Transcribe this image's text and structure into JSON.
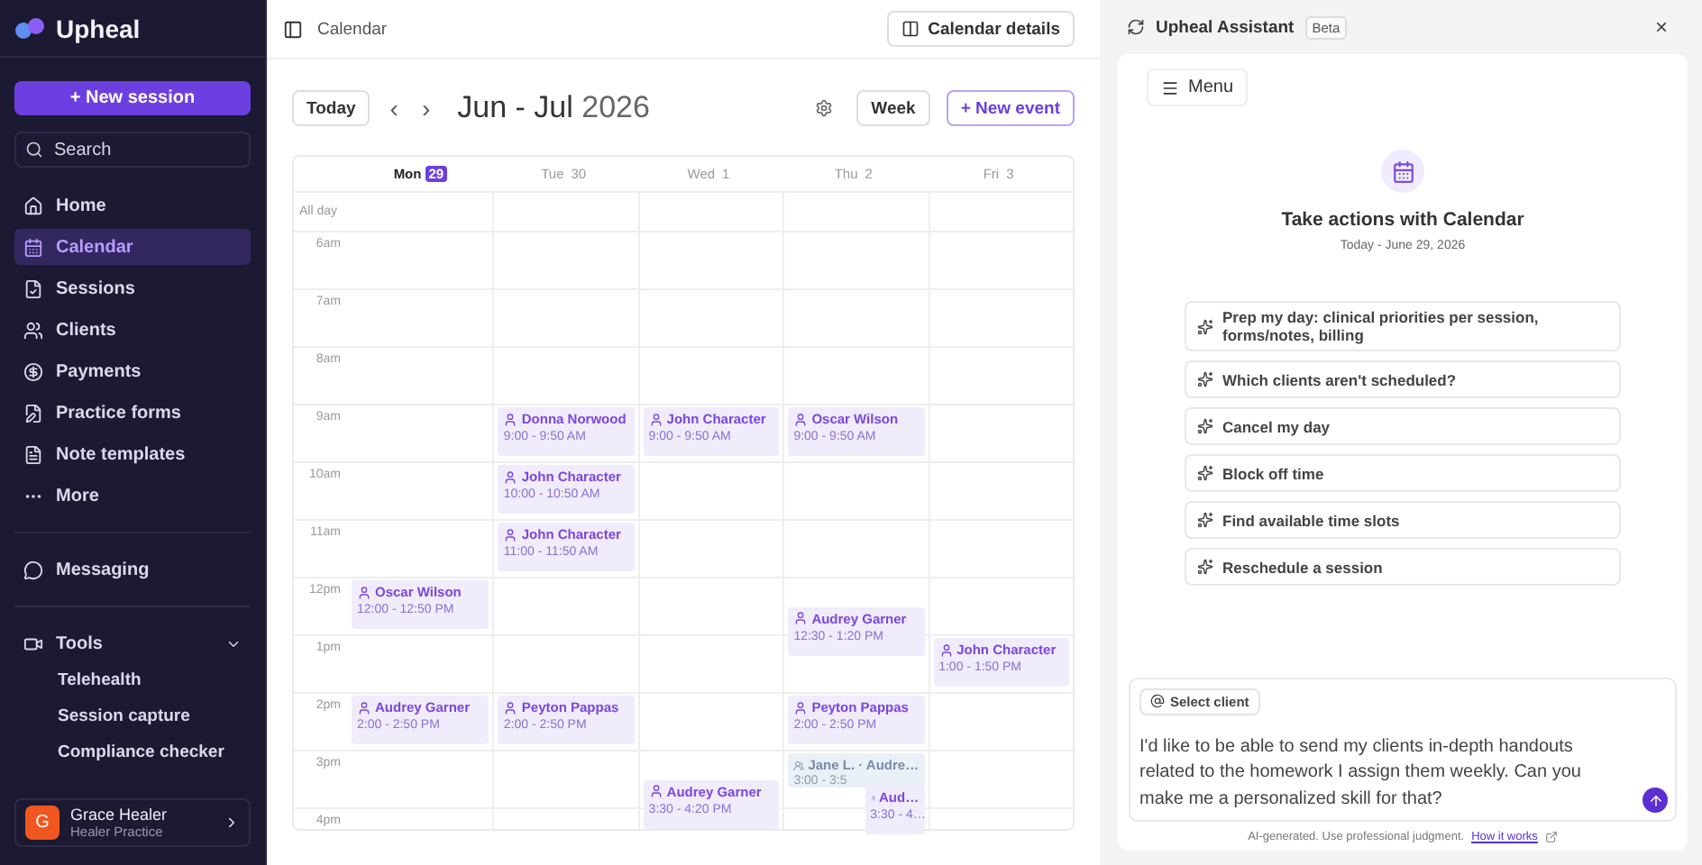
{
  "sidebar": {
    "brand": "Upheal",
    "new_session": "+ New session",
    "search_placeholder": "Search",
    "items": [
      {
        "label": "Home",
        "selected": false
      },
      {
        "label": "Calendar",
        "selected": true
      },
      {
        "label": "Sessions",
        "selected": false
      },
      {
        "label": "Clients",
        "selected": false
      },
      {
        "label": "Payments",
        "selected": false
      },
      {
        "label": "Practice forms",
        "selected": false
      },
      {
        "label": "Note templates",
        "selected": false
      },
      {
        "label": "More",
        "selected": false
      }
    ],
    "messaging": "Messaging",
    "tools": {
      "label": "Tools",
      "expanded": true,
      "children": [
        "Telehealth",
        "Session capture",
        "Compliance checker"
      ]
    },
    "user": {
      "initial": "G",
      "name": "Grace Healer",
      "practice": "Healer Practice"
    }
  },
  "main": {
    "breadcrumb": "Calendar",
    "details_button": "Calendar details",
    "today_button": "Today",
    "prev": "‹",
    "next": "›",
    "range": "Jun - Jul",
    "year": "2026",
    "view_button": "Week",
    "new_event_button": "+ New event",
    "calendar": {
      "days": [
        {
          "day": "Mon",
          "date": "29",
          "selected": true
        },
        {
          "day": "Tue",
          "date": "30",
          "selected": false
        },
        {
          "day": "Wed",
          "date": "1",
          "selected": false
        },
        {
          "day": "Thu",
          "date": "2",
          "selected": false
        },
        {
          "day": "Fri",
          "date": "3",
          "selected": false
        }
      ],
      "all_day": "All day",
      "hours": [
        {
          "label": "6am"
        },
        {
          "label": "7am"
        },
        {
          "label": "8am"
        },
        {
          "label": "9am",
          "cells": [
            [],
            [
              {
                "name": "Donna Norwood",
                "time": "9:00 - 9:50 AM",
                "kind": "client",
                "half_past": false,
                "beside": false
              }
            ],
            [
              {
                "name": "John Character",
                "time": "9:00 - 9:50 AM",
                "kind": "client",
                "half_past": false,
                "beside": false
              }
            ],
            [
              {
                "name": "Oscar Wilson",
                "time": "9:00 - 9:50 AM",
                "kind": "client",
                "half_past": false,
                "beside": false
              }
            ],
            []
          ]
        },
        {
          "label": "10am",
          "cells": [
            [],
            [
              {
                "name": "John Character",
                "time": "10:00 - 10:50 AM",
                "kind": "client",
                "half_past": false,
                "beside": false
              }
            ],
            [],
            [],
            []
          ]
        },
        {
          "label": "11am",
          "cells": [
            [],
            [
              {
                "name": "John Character",
                "time": "11:00 - 11:50 AM",
                "kind": "client",
                "half_past": false,
                "beside": false
              }
            ],
            [],
            [],
            []
          ]
        },
        {
          "label": "12pm",
          "cells": [
            [
              {
                "name": "Oscar Wilson",
                "time": "12:00 - 12:50 PM",
                "kind": "client",
                "half_past": false,
                "beside": false
              }
            ],
            [],
            [],
            [
              {
                "name": "Audrey Garner",
                "time": "12:30 - 1:20 PM",
                "kind": "client",
                "half_past": true,
                "beside": false
              }
            ],
            []
          ]
        },
        {
          "label": "1pm",
          "cells": [
            [],
            [],
            [],
            [],
            [
              {
                "name": "John Character",
                "time": "1:00 - 1:50 PM",
                "kind": "client",
                "half_past": false,
                "beside": false
              }
            ]
          ]
        },
        {
          "label": "2pm",
          "cells": [
            [
              {
                "name": "Audrey Garner",
                "time": "2:00 - 2:50 PM",
                "kind": "client",
                "half_past": false,
                "beside": false
              }
            ],
            [
              {
                "name": "Peyton Pappas",
                "time": "2:00 - 2:50 PM",
                "kind": "client",
                "half_past": false,
                "beside": false
              }
            ],
            [],
            [
              {
                "name": "Peyton Pappas",
                "time": "2:00 - 2:50 PM",
                "kind": "client",
                "half_past": false,
                "beside": false
              }
            ],
            []
          ]
        },
        {
          "label": "3pm",
          "cells": [
            [],
            [],
            [
              {
                "name": "Audrey Garner",
                "time": "3:30 - 4:20 PM",
                "kind": "client",
                "half_past": true,
                "beside": false
              }
            ],
            [
              {
                "name": "Jane L. · Audre…",
                "time": "3:00 - 3:5",
                "kind": "group",
                "half_past": false,
                "beside": false
              },
              {
                "name": "Aud…",
                "time": "3:30 - 4…",
                "kind": "client",
                "half_past": true,
                "beside": true
              }
            ],
            []
          ]
        },
        {
          "label": "4pm"
        }
      ]
    }
  },
  "assistant": {
    "title": "Upheal Assistant",
    "badge": "Beta",
    "close": "×",
    "menu_button": "Menu",
    "heading": "Take actions with Calendar",
    "subheading": "Today - June 29, 2026",
    "suggestions": [
      "Prep my day: clinical priorities per session, forms/notes, billing",
      "Which clients aren't scheduled?",
      "Cancel my day",
      "Block off time",
      "Find available time slots",
      "Reschedule a session"
    ],
    "composer": {
      "chip": "Select client",
      "value": "I'd like to be able to send my clients in-depth handouts related to the homework I assign them weekly. Can you make me a personalized skill for that?"
    },
    "disclaimer": "AI-generated. Use professional judgment.",
    "link": "How it works"
  }
}
